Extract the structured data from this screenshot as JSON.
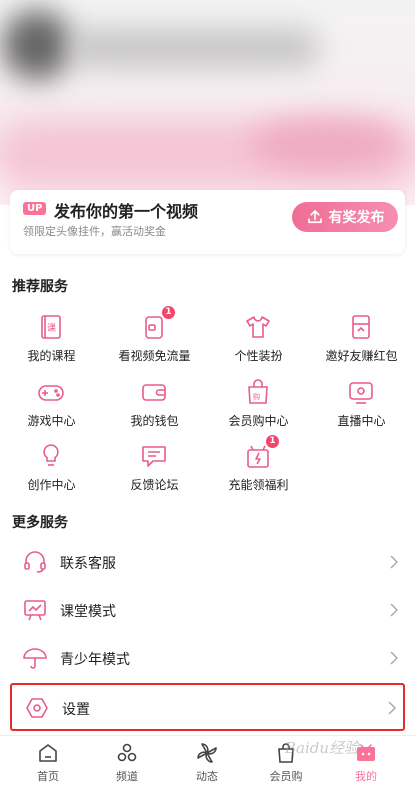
{
  "upload_card": {
    "badge": "UP",
    "title": "发布你的第一个视频",
    "subtitle": "领限定头像挂件，赢活动奖金",
    "cta_label": "有奖发布"
  },
  "recommended": {
    "title": "推荐服务",
    "items": [
      {
        "label": "我的课程",
        "icon": "course-icon"
      },
      {
        "label": "看视频免流量",
        "icon": "free-data-icon",
        "badge": "1"
      },
      {
        "label": "个性装扮",
        "icon": "tshirt-icon"
      },
      {
        "label": "邀好友赚红包",
        "icon": "invite-icon"
      },
      {
        "label": "游戏中心",
        "icon": "gamepad-icon"
      },
      {
        "label": "我的钱包",
        "icon": "wallet-icon"
      },
      {
        "label": "会员购中心",
        "icon": "shopping-bag-icon"
      },
      {
        "label": "直播中心",
        "icon": "live-tv-icon"
      },
      {
        "label": "创作中心",
        "icon": "lightbulb-icon"
      },
      {
        "label": "反馈论坛",
        "icon": "feedback-icon"
      },
      {
        "label": "充能领福利",
        "icon": "gift-icon",
        "badge": "1"
      }
    ]
  },
  "more": {
    "title": "更多服务",
    "items": [
      {
        "label": "联系客服",
        "icon": "headset-icon"
      },
      {
        "label": "课堂模式",
        "icon": "classroom-icon"
      },
      {
        "label": "青少年模式",
        "icon": "umbrella-icon"
      },
      {
        "label": "设置",
        "icon": "settings-icon",
        "highlighted": true
      }
    ]
  },
  "tabbar": {
    "items": [
      {
        "label": "首页",
        "icon": "home-icon"
      },
      {
        "label": "频道",
        "icon": "channel-icon"
      },
      {
        "label": "动态",
        "icon": "windmill-icon"
      },
      {
        "label": "会员购",
        "icon": "shop-icon"
      },
      {
        "label": "我的",
        "icon": "tv-mascot-icon",
        "active": true
      }
    ]
  },
  "watermark": "Baidu经验",
  "colors": {
    "accent": "#fb7299",
    "highlight_border": "#e32b2b",
    "badge": "#f3466c"
  }
}
